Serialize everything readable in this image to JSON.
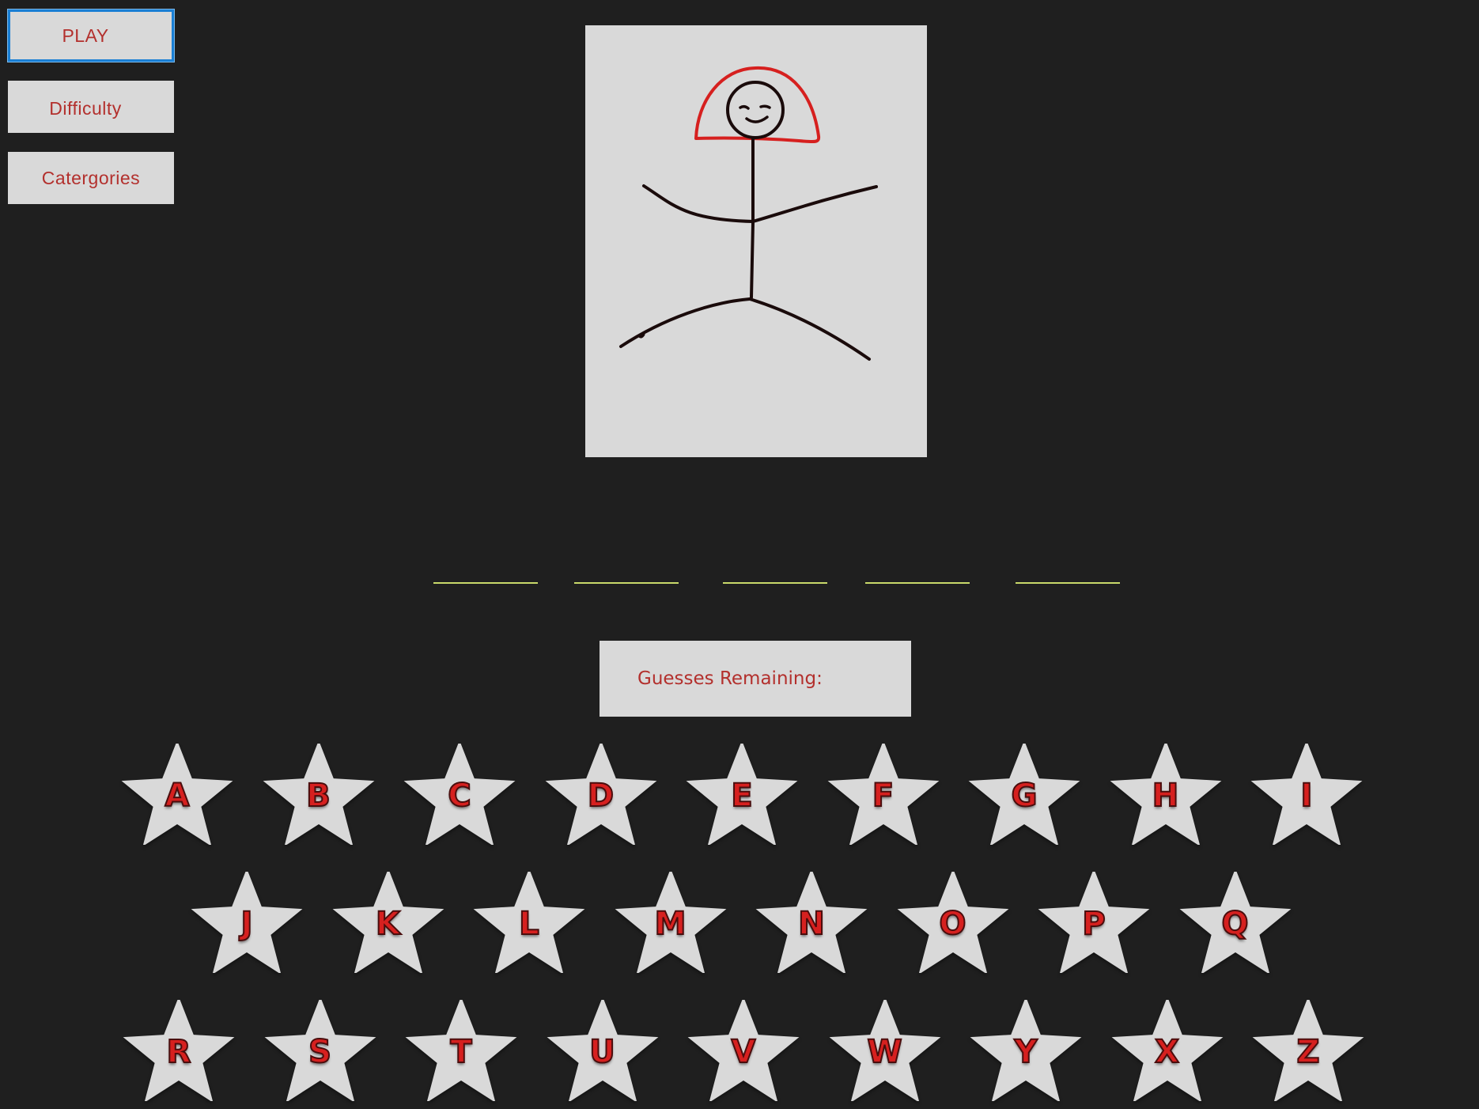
{
  "menu": {
    "play_label": "PLAY",
    "difficulty_label": "Difficulty",
    "categories_label": "Catergories"
  },
  "status": {
    "guesses_label": "Guesses Remaining:"
  },
  "word": {
    "blank_count": 5
  },
  "keyboard": {
    "rows": [
      [
        "A",
        "B",
        "C",
        "D",
        "E",
        "F",
        "G",
        "H",
        "I"
      ],
      [
        "J",
        "K",
        "L",
        "M",
        "N",
        "O",
        "P",
        "Q"
      ],
      [
        "R",
        "S",
        "T",
        "U",
        "V",
        "W",
        "Y",
        "X",
        "Z"
      ]
    ]
  },
  "colors": {
    "background": "#1f1f1f",
    "panel": "#d9d9d9",
    "accent_text": "#b3302d",
    "letter_red": "#d6201f",
    "blank_line": "#c9d96a",
    "focus_border": "#1a7fd4"
  },
  "icons": {
    "hangman": "stick-figure-with-red-hat",
    "letter_key": "star-icon"
  }
}
